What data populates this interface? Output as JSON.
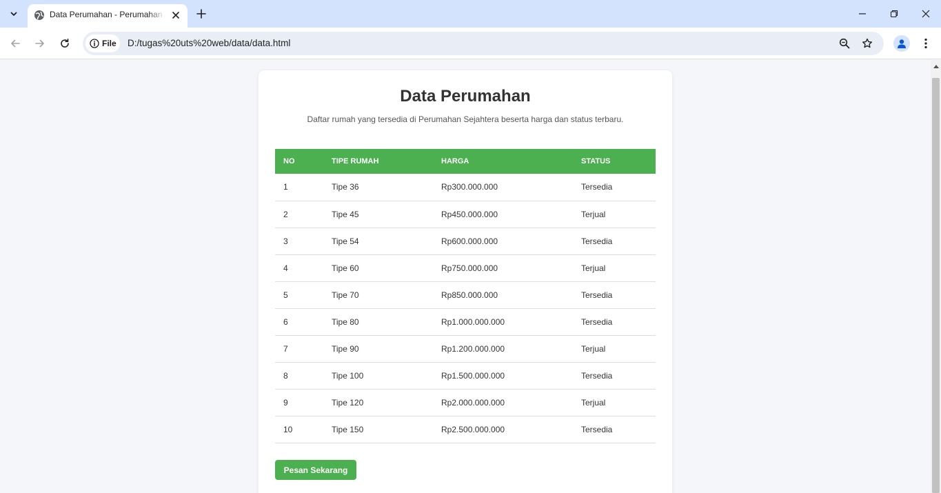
{
  "browser": {
    "tab_title": "Data Perumahan - Perumahan Sejahtera",
    "chip_label": "File",
    "url": "D:/tugas%20uts%20web/data/data.html",
    "accent": "#d3e3fd"
  },
  "page": {
    "title": "Data Perumahan",
    "description": "Daftar rumah yang tersedia di Perumahan Sejahtera beserta harga dan status terbaru.",
    "accent_color": "#4caf50",
    "table": {
      "headers": [
        "No",
        "Tipe Rumah",
        "Harga",
        "Status"
      ],
      "rows": [
        [
          "1",
          "Tipe 36",
          "Rp300.000.000",
          "Tersedia"
        ],
        [
          "2",
          "Tipe 45",
          "Rp450.000.000",
          "Terjual"
        ],
        [
          "3",
          "Tipe 54",
          "Rp600.000.000",
          "Tersedia"
        ],
        [
          "4",
          "Tipe 60",
          "Rp750.000.000",
          "Terjual"
        ],
        [
          "5",
          "Tipe 70",
          "Rp850.000.000",
          "Tersedia"
        ],
        [
          "6",
          "Tipe 80",
          "Rp1.000.000.000",
          "Tersedia"
        ],
        [
          "7",
          "Tipe 90",
          "Rp1.200.000.000",
          "Terjual"
        ],
        [
          "8",
          "Tipe 100",
          "Rp1.500.000.000",
          "Tersedia"
        ],
        [
          "9",
          "Tipe 120",
          "Rp2.000.000.000",
          "Terjual"
        ],
        [
          "10",
          "Tipe 150",
          "Rp2.500.000.000",
          "Tersedia"
        ]
      ]
    },
    "order_button_label": "Pesan Sekarang"
  }
}
